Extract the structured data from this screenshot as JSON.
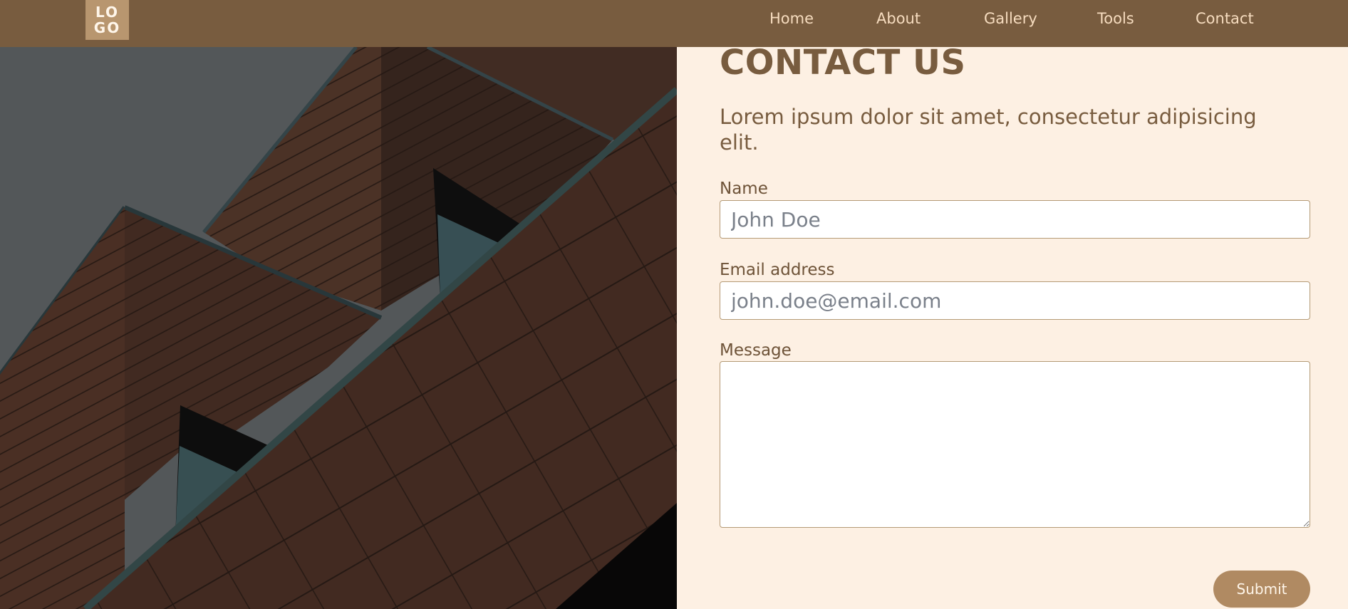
{
  "header": {
    "logo_line1": "LO",
    "logo_line2": "GO",
    "nav": [
      {
        "label": "Home"
      },
      {
        "label": "About"
      },
      {
        "label": "Gallery"
      },
      {
        "label": "Tools"
      },
      {
        "label": "Contact"
      }
    ]
  },
  "contact": {
    "title": "CONTACT US",
    "lead": "Lorem ipsum dolor sit amet, consectetur adipisicing elit.",
    "name_label": "Name",
    "name_placeholder": "John Doe",
    "email_label": "Email address",
    "email_placeholder": "john.doe@email.com",
    "message_label": "Message",
    "message_value": "",
    "submit_label": "Submit"
  },
  "colors": {
    "header_bg": "#785c3f",
    "page_bg": "#fdf0e3",
    "accent": "#b08a62",
    "nav_text": "#f6dcbf"
  },
  "icons": {
    "textarea_resize": "resize-grip-icon"
  }
}
